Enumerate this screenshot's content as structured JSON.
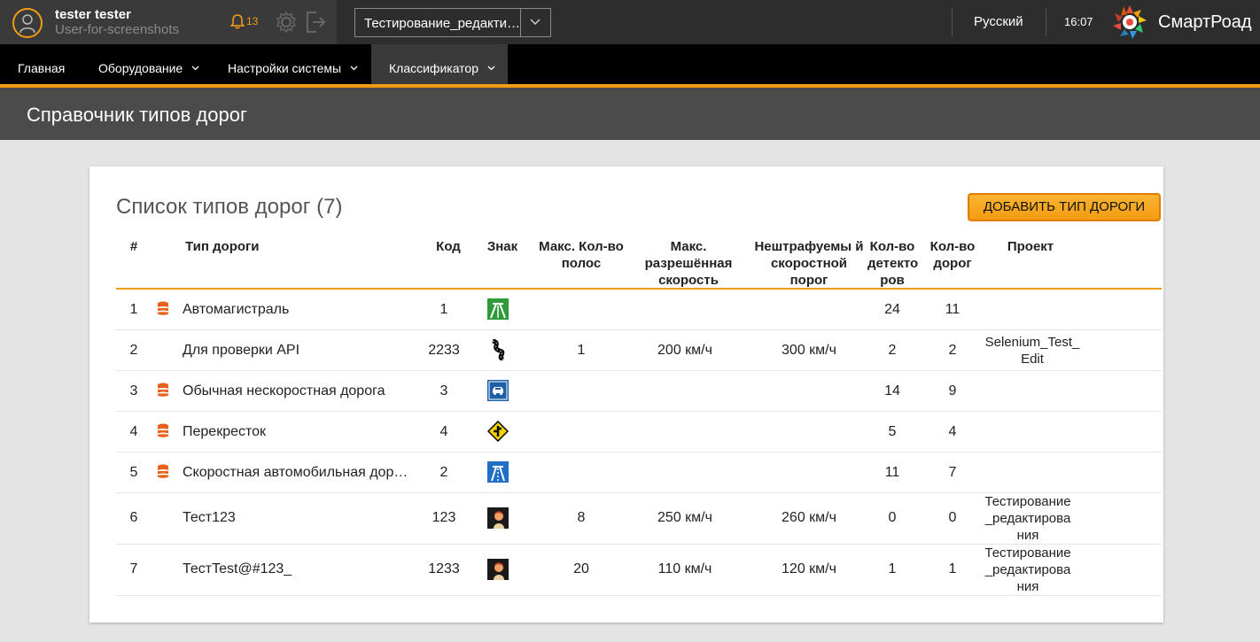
{
  "header": {
    "user_name": "tester tester",
    "user_login": "User-for-screenshots",
    "notifications_count": "13",
    "project_selected": "Тестирование_редакти…",
    "language": "Русский",
    "time": "16:07",
    "brand": "СмартРоад"
  },
  "nav": {
    "items": [
      {
        "label": "Главная"
      },
      {
        "label": "Оборудование"
      },
      {
        "label": "Настройки системы"
      },
      {
        "label": "Классификатор"
      }
    ]
  },
  "page": {
    "title": "Справочник типов дорог"
  },
  "list": {
    "title": "Список типов дорог (7)",
    "add_button": "ДОБАВИТЬ ТИП ДОРОГИ"
  },
  "table": {
    "headers": {
      "num": "#",
      "type": "Тип дороги",
      "code": "Код",
      "sign": "Знак",
      "lanes": "Макс. Кол-во полос",
      "speed": "Макс. разрешённая скорость",
      "threshold": "Нештрафуемы й скоростной порог",
      "detectors": "Кол-во детекто ров",
      "roads": "Кол-во дорог",
      "project": "Проект"
    },
    "rows": [
      {
        "num": "1",
        "db": true,
        "type": "Автомагистраль",
        "code": "1",
        "sign": "motorway-sign-icon",
        "lanes": "",
        "speed": "",
        "threshold": "",
        "detectors": "24",
        "roads": "11",
        "project": ""
      },
      {
        "num": "2",
        "db": false,
        "type": "Для проверки API",
        "code": "2233",
        "sign": "winding-road-sign-icon",
        "lanes": "1",
        "speed": "200 км/ч",
        "threshold": "300 км/ч",
        "detectors": "2",
        "roads": "2",
        "project": "Selenium_Test_Edit"
      },
      {
        "num": "3",
        "db": true,
        "type": "Обычная нескоростная дорога",
        "code": "3",
        "sign": "car-road-sign-icon",
        "lanes": "",
        "speed": "",
        "threshold": "",
        "detectors": "14",
        "roads": "9",
        "project": ""
      },
      {
        "num": "4",
        "db": true,
        "type": "Перекресток",
        "code": "4",
        "sign": "junction-sign-icon",
        "lanes": "",
        "speed": "",
        "threshold": "",
        "detectors": "5",
        "roads": "4",
        "project": ""
      },
      {
        "num": "5",
        "db": true,
        "type": "Скоростная автомобильная дор…",
        "code": "2",
        "sign": "expressway-sign-icon",
        "lanes": "",
        "speed": "",
        "threshold": "",
        "detectors": "11",
        "roads": "7",
        "project": ""
      },
      {
        "num": "6",
        "db": false,
        "type": "Тест123",
        "code": "123",
        "sign": "custom-image-icon",
        "lanes": "8",
        "speed": "250 км/ч",
        "threshold": "260 км/ч",
        "detectors": "0",
        "roads": "0",
        "project": "Тестирование_редактирования"
      },
      {
        "num": "7",
        "db": false,
        "type": "ТестTest@#123_",
        "code": "1233",
        "sign": "custom-image-icon",
        "lanes": "20",
        "speed": "110 км/ч",
        "threshold": "120 км/ч",
        "detectors": "1",
        "roads": "1",
        "project": "Тестирование_редактирования"
      }
    ]
  },
  "colors": {
    "accent": "#f39c12",
    "topbar": "#2d2d2d",
    "nav": "#000000",
    "page_header": "#4b4b4b",
    "db_icon": "#e8601c"
  }
}
